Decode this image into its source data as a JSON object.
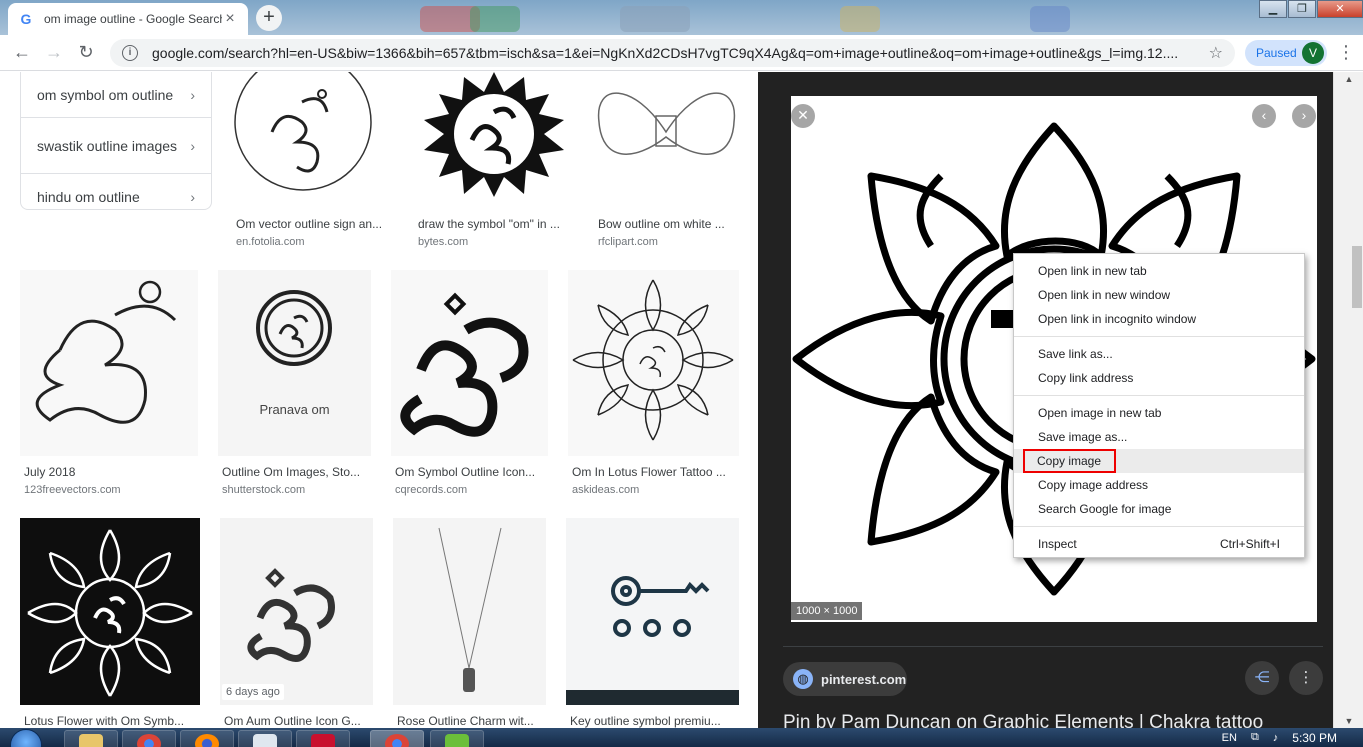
{
  "browser": {
    "tab_title": "om image outline - Google Search",
    "tab_favicon": "G",
    "new_tab": "+",
    "url": "google.com/search?hl=en-US&biw=1366&bih=657&tbm=isch&sa=1&ei=NgKnXd2CDsH7vgTC9qX4Ag&q=om+image+outline&oq=om+image+outline&gs_l=img.12....",
    "profile_status": "Paused",
    "profile_initial": "V"
  },
  "related_searches": [
    {
      "label": "om symbol om outline"
    },
    {
      "label": "swastik outline images"
    },
    {
      "label": "hindu om outline"
    }
  ],
  "results": [
    {
      "title": "Om vector outline sign an...",
      "source": "en.fotolia.com"
    },
    {
      "title": "draw the symbol \"om\" in ...",
      "source": "bytes.com"
    },
    {
      "title": "Bow outline om white ...",
      "source": "rfclipart.com"
    },
    {
      "title": "July 2018",
      "source": "123freevectors.com"
    },
    {
      "title": "Outline Om Images, Sto...",
      "source": "shutterstock.com",
      "thumb_text": "Pranava om"
    },
    {
      "title": "Om Symbol Outline Icon...",
      "source": "cqrecords.com"
    },
    {
      "title": "Om In Lotus Flower Tattoo ...",
      "source": "askideas.com"
    },
    {
      "title": "Lotus Flower with Om Symb...",
      "source": ""
    },
    {
      "title": "Om Aum Outline Icon G...",
      "source": "",
      "badge": "6 days ago"
    },
    {
      "title": "Rose Outline Charm wit...",
      "source": ""
    },
    {
      "title": "Key outline symbol premiu...",
      "source": ""
    }
  ],
  "panel": {
    "dimensions": "1000 × 1000",
    "site": "pinterest.com",
    "title": "Pin by Pam Duncan on Graphic Elements | Chakra tattoo"
  },
  "context_menu": {
    "groups": [
      [
        {
          "label": "Open link in new tab"
        },
        {
          "label": "Open link in new window"
        },
        {
          "label": "Open link in incognito window"
        }
      ],
      [
        {
          "label": "Save link as..."
        },
        {
          "label": "Copy link address"
        }
      ],
      [
        {
          "label": "Open image in new tab"
        },
        {
          "label": "Save image as..."
        },
        {
          "label": "Copy image",
          "highlighted": true
        },
        {
          "label": "Copy image address"
        },
        {
          "label": "Search Google for image"
        }
      ],
      [
        {
          "label": "Inspect",
          "shortcut": "Ctrl+Shift+I"
        }
      ]
    ]
  },
  "taskbar": {
    "language": "EN",
    "time": "5:30 PM"
  },
  "colors": {
    "accent": "#1a73e8",
    "highlight_outline": "#e00000",
    "panel_bg": "#222222"
  }
}
